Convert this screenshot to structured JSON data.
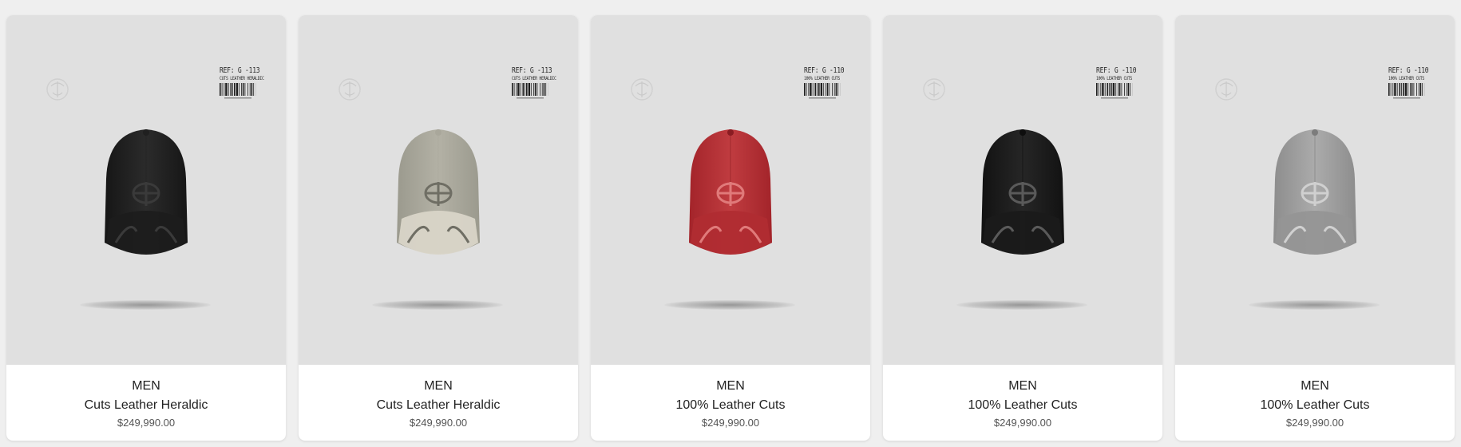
{
  "products": [
    {
      "category": "MEN",
      "name": "Cuts Leather Heraldic",
      "price": "$249,990.00",
      "ref": "REF: G -113",
      "tag_line": "CUTS LEATHER HERALDIC",
      "cap_color": "#161616",
      "cap_light": "#2b2b2b",
      "cap_visor": "#202020",
      "emblem_color": "#3a3a3a",
      "front_panel": "#1c1c1c"
    },
    {
      "category": "MEN",
      "name": "Cuts Leather Heraldic",
      "price": "$249,990.00",
      "ref": "REF: G -113",
      "tag_line": "CUTS LEATHER HERALDIC",
      "cap_color": "#9b9a8e",
      "cap_light": "#b3b1a5",
      "cap_visor": "#a9a79b",
      "emblem_color": "#6f6e64",
      "front_panel": "#d9d5c8"
    },
    {
      "category": "MEN",
      "name": "100% Leather Cuts",
      "price": "$249,990.00",
      "ref": "REF: G -110",
      "tag_line": "100% LEATHER CUTS",
      "cap_color": "#a3242a",
      "cap_light": "#c03c40",
      "cap_visor": "#8a1c22",
      "emblem_color": "#e07a7a",
      "front_panel": "#b02c31"
    },
    {
      "category": "MEN",
      "name": "100% Leather Cuts",
      "price": "$249,990.00",
      "ref": "REF: G -110",
      "tag_line": "100% LEATHER CUTS",
      "cap_color": "#121212",
      "cap_light": "#262626",
      "cap_visor": "#0e0e0e",
      "emblem_color": "#5a5a5a",
      "front_panel": "#1a1a1a"
    },
    {
      "category": "MEN",
      "name": "100% Leather Cuts",
      "price": "$249,990.00",
      "ref": "REF: G -110",
      "tag_line": "100% LEATHER CUTS",
      "cap_color": "#8d8d8d",
      "cap_light": "#ababab",
      "cap_visor": "#7c7c7c",
      "emblem_color": "#d0d0d0",
      "front_panel": "#959595"
    }
  ],
  "icons": {
    "brand_logo": "brand-logo-icon",
    "barcode": "barcode-icon"
  }
}
